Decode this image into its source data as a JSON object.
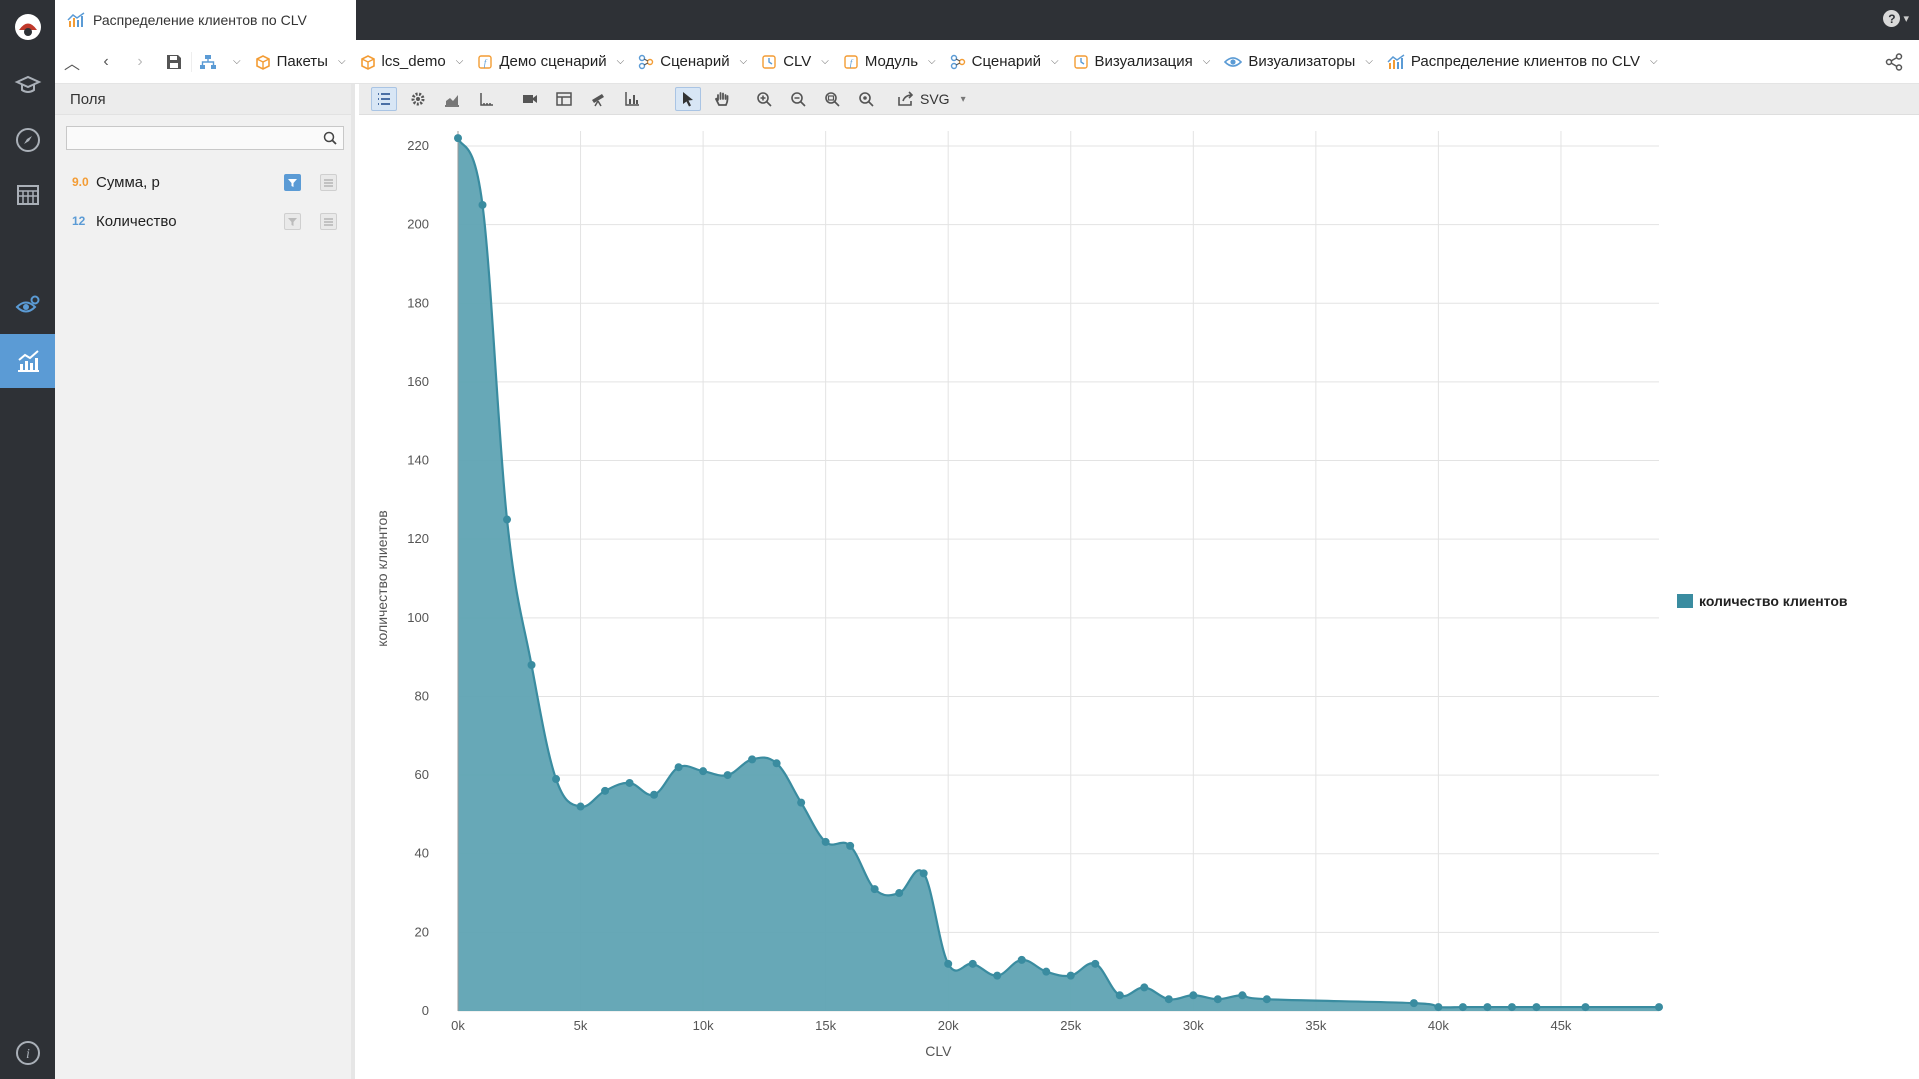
{
  "window": {
    "tab_title": "Распределение клиентов по CLV",
    "help_label": "?"
  },
  "breadcrumbs": [
    {
      "label": "",
      "icon": "tree-icon"
    },
    {
      "label": "Пакеты",
      "icon": "package-icon"
    },
    {
      "label": "lcs_demo",
      "icon": "package-icon"
    },
    {
      "label": "Демо сценарий",
      "icon": "module-icon"
    },
    {
      "label": "Сценарий",
      "icon": "scenario-icon"
    },
    {
      "label": "CLV",
      "icon": "clock-icon"
    },
    {
      "label": "Модуль",
      "icon": "module-icon"
    },
    {
      "label": "Сценарий",
      "icon": "scenario-icon"
    },
    {
      "label": "Визуализация",
      "icon": "clock-icon"
    },
    {
      "label": "Визуализаторы",
      "icon": "eye-icon"
    },
    {
      "label": "Распределение клиентов по CLV",
      "icon": "chart-icon"
    }
  ],
  "fields_panel": {
    "title": "Поля",
    "search_placeholder": "",
    "fields": [
      {
        "type": "9.0",
        "label": "Сумма, р",
        "type_color": "#f39c34",
        "enabled": true
      },
      {
        "type": "12",
        "label": "Количество",
        "type_color": "#5b9bd5",
        "enabled": false
      }
    ]
  },
  "toolbar": {
    "export_label": "SVG"
  },
  "colors": {
    "accent": "#5b9bd5",
    "series": "#3a8ca0",
    "series_fill": "#5fa3b3",
    "rail": "#2e3136"
  },
  "chart_data": {
    "type": "area",
    "xlabel": "CLV",
    "ylabel": "количество клиентов",
    "xlim": [
      0,
      49000
    ],
    "ylim": [
      0,
      220
    ],
    "x_ticks": [
      "0k",
      "5k",
      "10k",
      "15k",
      "20k",
      "25k",
      "30k",
      "35k",
      "40k",
      "45k"
    ],
    "y_ticks": [
      "0",
      "20",
      "40",
      "60",
      "80",
      "100",
      "120",
      "140",
      "160",
      "180",
      "200",
      "220"
    ],
    "grid": true,
    "legend_position": "right",
    "series": [
      {
        "name": "количество клиентов",
        "x": [
          0,
          1000,
          2000,
          3000,
          4000,
          5000,
          6000,
          7000,
          8000,
          9000,
          10000,
          11000,
          12000,
          13000,
          14000,
          15000,
          16000,
          17000,
          18000,
          19000,
          20000,
          21000,
          22000,
          23000,
          24000,
          25000,
          26000,
          27000,
          28000,
          29000,
          30000,
          31000,
          32000,
          33000,
          39000,
          40000,
          41000,
          42000,
          43000,
          44000,
          46000,
          49000
        ],
        "y": [
          222,
          205,
          125,
          88,
          59,
          52,
          56,
          58,
          55,
          62,
          61,
          60,
          64,
          63,
          53,
          43,
          42,
          31,
          30,
          35,
          12,
          12,
          9,
          13,
          10,
          9,
          12,
          4,
          6,
          3,
          4,
          3,
          4,
          3,
          2,
          1,
          1,
          1,
          1,
          1,
          1,
          1
        ]
      }
    ]
  }
}
